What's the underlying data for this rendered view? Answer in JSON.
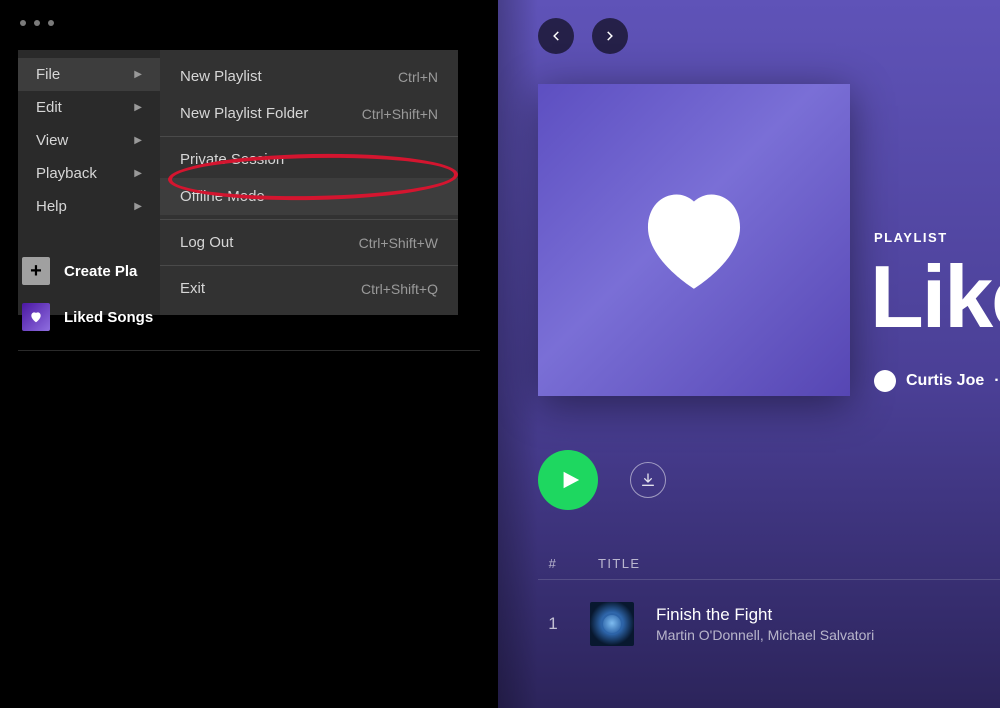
{
  "menu": {
    "top": [
      {
        "label": "File",
        "hovered": true
      },
      {
        "label": "Edit"
      },
      {
        "label": "View"
      },
      {
        "label": "Playback"
      },
      {
        "label": "Help"
      }
    ],
    "file_submenu": {
      "group1": [
        {
          "label": "New Playlist",
          "shortcut": "Ctrl+N"
        },
        {
          "label": "New Playlist Folder",
          "shortcut": "Ctrl+Shift+N"
        }
      ],
      "group2": [
        {
          "label": "Private Session",
          "shortcut": ""
        },
        {
          "label": "Offline Mode",
          "shortcut": "",
          "hovered": true
        }
      ],
      "group3": [
        {
          "label": "Log Out",
          "shortcut": "Ctrl+Shift+W"
        }
      ],
      "group4": [
        {
          "label": "Exit",
          "shortcut": "Ctrl+Shift+Q"
        }
      ]
    }
  },
  "sidebar": {
    "create_label": "Create Pla",
    "liked_label": "Liked Songs"
  },
  "playlist": {
    "type_label": "PLAYLIST",
    "title": "Like",
    "user": "Curtis Joe",
    "user_suffix": "·",
    "columns": {
      "num": "#",
      "title": "TITLE"
    },
    "tracks": [
      {
        "num": "1",
        "title": "Finish the Fight",
        "artist": "Martin O'Donnell, Michael Salvatori"
      }
    ]
  }
}
